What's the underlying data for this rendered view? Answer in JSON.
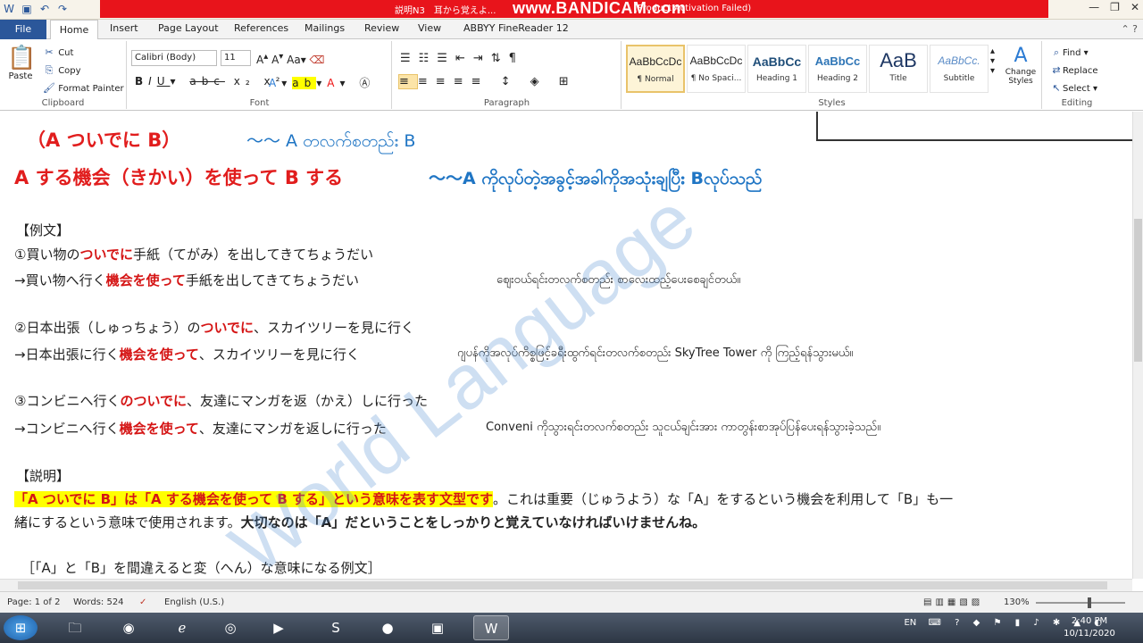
{
  "window": {
    "doc_title": "説明N3　耳から覚えよ...",
    "bandicam_brand": "www.BANDICAM.com",
    "activation_note": "(Product Activation Failed)"
  },
  "tabs": {
    "file": "File",
    "home": "Home",
    "insert": "Insert",
    "page_layout": "Page Layout",
    "references": "References",
    "mailings": "Mailings",
    "review": "Review",
    "view": "View",
    "abbyy": "ABBYY FineReader 12"
  },
  "clipboard": {
    "label": "Clipboard",
    "paste": "Paste",
    "cut": "Cut",
    "copy": "Copy",
    "format_painter": "Format Painter"
  },
  "font": {
    "label": "Font",
    "family": "Calibri (Body)",
    "size": "11"
  },
  "paragraph": {
    "label": "Paragraph"
  },
  "styles": {
    "label": "Styles",
    "tiles": [
      {
        "preview": "AaBbCcDc",
        "name": "¶ Normal"
      },
      {
        "preview": "AaBbCcDc",
        "name": "¶ No Spaci..."
      },
      {
        "preview": "AaBbCc",
        "name": "Heading 1"
      },
      {
        "preview": "AaBbCc",
        "name": "Heading 2"
      },
      {
        "preview": "AaB",
        "name": "Title"
      },
      {
        "preview": "AaBbCc.",
        "name": "Subtitle"
      }
    ],
    "change_styles": "Change Styles"
  },
  "editing": {
    "label": "Editing",
    "find": "Find",
    "replace": "Replace",
    "select": "Select"
  },
  "document": {
    "line1_jp": "（A ついでに B）",
    "line1_my": "〜〜 A တလက်စတည်း B",
    "line2_jp": "A する機会（きかい）を使って B する",
    "line2_my": "〜〜A ကိုလုပ်တဲ့အခွင့်အခါကိုအသုံးချပြီး Bလုပ်သည်",
    "example_header": "【例文】",
    "ex1a_pre": "①買い物の",
    "ex1a_red": "ついでに",
    "ex1a_post": "手紙（てがみ）を出してきてちょうだい",
    "ex1b_pre": "→買い物へ行く",
    "ex1b_red": "機会を使って",
    "ex1b_post": "手紙を出してきてちょうだい",
    "ex1b_my": "ဈေးဝယ်ရင်းတလက်စတည်း စာလေးထည့်ပေးစေချင်တယ်။",
    "ex2a_pre": "②日本出張（しゅっちょう）の",
    "ex2a_red": "ついでに",
    "ex2a_post": "、スカイツリーを見に行く",
    "ex2b_pre": "→日本出張に行く",
    "ex2b_red": "機会を使って",
    "ex2b_post": "、スカイツリーを見に行く",
    "ex2b_my": "ဂျပန်ကိုအလုပ်ကိစ္စဖြင့်ခရီးထွက်ရင်းတလက်စတည်း SkyTree Tower ကို ကြည့်ရန်သွားမယ်။",
    "ex3a_pre": "③コンビニへ行く",
    "ex3a_red": "のついでに",
    "ex3a_post": "、友達にマンガを返（かえ）しに行った",
    "ex3b_pre": "→コンビニへ行く",
    "ex3b_red": "機会を使って",
    "ex3b_post": "、友達にマンガを返しに行った",
    "ex3b_my": "Conveni ကိုသွားရင်းတလက်စတည်း သူငယ်ချင်းအား ကာတွန်းစာအုပ်ပြန်ပေးရန်သွားခဲ့သည်။",
    "explain_header": "【説明】",
    "explain_hl": "「A ついでに B」は「A する機会を使って B する」という意味を表す文型です",
    "explain_rest1": "。これは重要（じゅうよう）な「A」をするという機会を利用して「B」も一",
    "explain_rest2": "緒にするという意味で使用されます。",
    "explain_bold": "大切なのは「A」だということをしっかりと覚えていなければいけませんね。",
    "wrong_header": "［「A」と「B」を間違えると変（へん）な意味になる例文］",
    "watermark": "World Language"
  },
  "status": {
    "page": "Page: 1 of 2",
    "words": "Words: 524",
    "language": "English (U.S.)",
    "zoom": "130%"
  },
  "taskbar": {
    "lang": "EN",
    "time": "2:40 PM",
    "date": "10/11/2020"
  }
}
